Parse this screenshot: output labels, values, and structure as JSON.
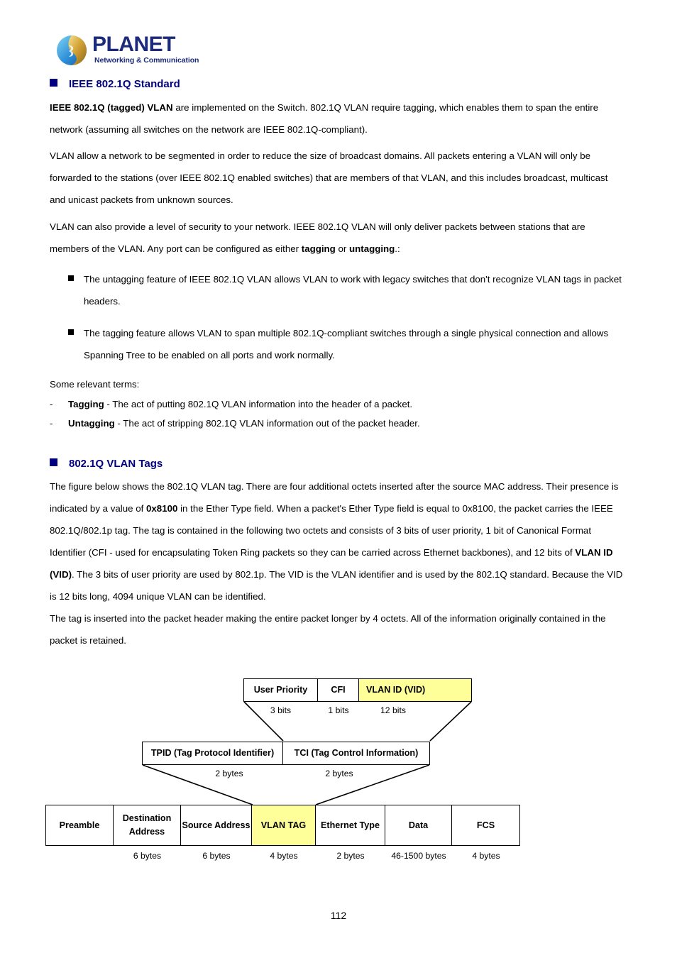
{
  "logo": {
    "wordmark": "PLANET",
    "tagline": "Networking & Communication",
    "colors": {
      "navy": "#1b2a7a",
      "globe_left": "#2f8fd8",
      "globe_right": "#c9962c"
    }
  },
  "headings": {
    "h1": "IEEE 802.1Q Standard",
    "h2": "802.1Q VLAN Tags",
    "color": "#000080"
  },
  "paragraphs": {
    "p1_bold": "IEEE 802.1Q (tagged) VLAN",
    "p1_rest": " are implemented on the Switch. 802.1Q VLAN require tagging, which enables them to span the entire network (assuming all switches on the network are IEEE 802.1Q-compliant).",
    "p2": "VLAN allow a network to be segmented in order to reduce the size of broadcast domains. All packets entering a VLAN will only be forwarded to the stations (over IEEE 802.1Q enabled switches) that are members of that VLAN, and this includes broadcast, multicast and unicast packets from unknown sources.",
    "p3_a": "VLAN can also provide a level of security to your network. IEEE 802.1Q VLAN will only deliver packets between stations that are members of the VLAN. Any port can be configured as either ",
    "p3_b1": "tagging",
    "p3_mid": " or ",
    "p3_b2": "untagging",
    "p3_end": ".:",
    "terms_intro": "Some relevant terms:",
    "p4_a": "The figure below shows the 802.1Q VLAN tag. There are four additional octets inserted after the source MAC address. Their presence is indicated by a value of ",
    "p4_b1": "0x8100",
    "p4_mid1": " in the Ether Type field. When a packet's Ether Type field is equal to 0x8100, the packet carries the IEEE 802.1Q/802.1p tag. The tag is contained in the following two octets and consists of 3 bits of user priority, 1 bit of Canonical Format Identifier (CFI - used for encapsulating Token Ring packets so they can be carried across Ethernet backbones), and 12 bits of ",
    "p4_b2": "VLAN ID (VID)",
    "p4_end": ". The 3 bits of user priority are used by 802.1p. The VID is the VLAN identifier and is used by the 802.1Q standard. Because the VID is 12 bits long, 4094 unique VLAN can be identified.",
    "p5": "The tag is inserted into the packet header making the entire packet longer by 4 octets. All of the information originally contained in the packet is retained."
  },
  "bullets": [
    "The untagging feature of IEEE 802.1Q VLAN allows VLAN to work with legacy switches that don't recognize VLAN tags in packet headers.",
    "The tagging feature allows VLAN to span multiple 802.1Q-compliant switches through a single physical connection and allows Spanning Tree to be enabled on all ports and work normally."
  ],
  "terms": [
    {
      "dash": "-",
      "term": "Tagging",
      "desc": " - The act of putting 802.1Q VLAN information into the header of a packet."
    },
    {
      "dash": "-",
      "term": "Untagging",
      "desc": " - The act of stripping 802.1Q VLAN information out of the packet header."
    }
  ],
  "diagram": {
    "tci_fields": [
      {
        "label": "User Priority",
        "size": "3 bits",
        "highlight": false
      },
      {
        "label": "CFI",
        "size": "1 bits",
        "highlight": false
      },
      {
        "label": "VLAN ID (VID)",
        "size": "12 bits",
        "highlight": true
      }
    ],
    "tag_fields": [
      {
        "label": "TPID (Tag Protocol Identifier)",
        "size": "2 bytes"
      },
      {
        "label": "TCI (Tag Control Information)",
        "size": "2 bytes"
      }
    ],
    "frame_fields": [
      {
        "label": "Preamble",
        "size": "",
        "highlight": false
      },
      {
        "label": "Destination Address",
        "size": "6 bytes",
        "highlight": false
      },
      {
        "label": "Source Address",
        "size": "6 bytes",
        "highlight": false
      },
      {
        "label": "VLAN TAG",
        "size": "4 bytes",
        "highlight": true
      },
      {
        "label": "Ethernet Type",
        "size": "2 bytes",
        "highlight": false
      },
      {
        "label": "Data",
        "size": "46-1500 bytes",
        "highlight": false
      },
      {
        "label": "FCS",
        "size": "4 bytes",
        "highlight": false
      }
    ],
    "highlight_color": "#ffff99"
  },
  "footer": {
    "page_number": "112"
  }
}
